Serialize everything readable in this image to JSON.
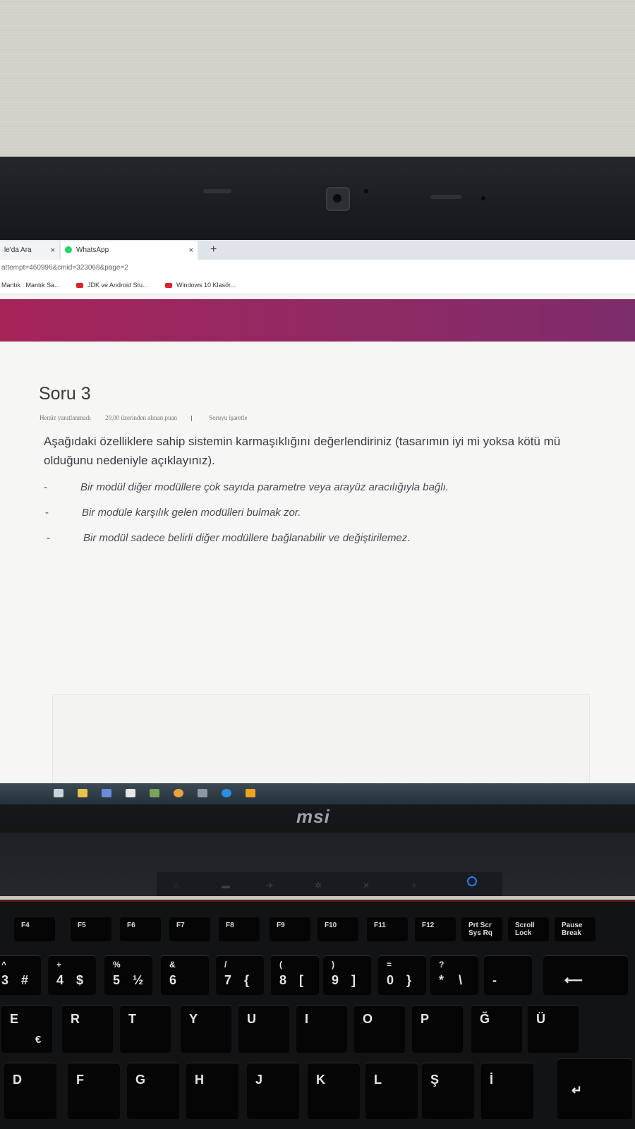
{
  "browser": {
    "tabs": [
      {
        "label": "le'da Ara"
      },
      {
        "label": "WhatsApp"
      }
    ],
    "url": "attempt=460996&cmid=323068&page=2",
    "bookmarks": [
      {
        "label": "Mantık : Mantık Sa..."
      },
      {
        "label": "JDK ve Android Stu..."
      },
      {
        "label": "Windows 10 Klasör..."
      }
    ],
    "accent_color": "#a52458"
  },
  "question": {
    "title": "Soru 3",
    "status": "Henüz yanıtlanmadı",
    "points": "20,00 üzerinden alınan puan",
    "flag_label": "Soruyu işaretle",
    "text": "Aşağıdaki özelliklere sahip sistemin karmaşıklığını değerlendiriniz (tasarımın iyi mi yoksa kötü mü olduğunu nedeniyle açıklayınız).",
    "bullets": [
      "Bir modül diğer modüllere çok sayıda parametre veya arayüz aracılığıyla bağlı.",
      "Bir modüle karşılık gelen modülleri bulmak zor.",
      "Bir modül sadece belirli diğer modüllere bağlanabilir ve değiştirilemez."
    ]
  },
  "laptop": {
    "brand": "msi"
  },
  "keyboard": {
    "fn_row": [
      "F4",
      "F5",
      "F6",
      "F7",
      "F8",
      "F9",
      "F10",
      "F11",
      "F12",
      "Prt Scr Sys Rq",
      "Scroll Lock",
      "Pause Break"
    ],
    "number_row": [
      {
        "main": "3",
        "sub": "^"
      },
      {
        "main": "#",
        "sub": ""
      },
      {
        "main": "4",
        "sub": "+"
      },
      {
        "main": "$",
        "sub": ""
      },
      {
        "main": "5",
        "sub": "%"
      },
      {
        "main": "½",
        "sub": ""
      },
      {
        "main": "6",
        "sub": "&"
      },
      {
        "main": "7",
        "sub": "/"
      },
      {
        "main": "{",
        "sub": ""
      },
      {
        "main": "8",
        "sub": "("
      },
      {
        "main": "[",
        "sub": ""
      },
      {
        "main": "9",
        "sub": ")"
      },
      {
        "main": "]",
        "sub": ""
      },
      {
        "main": "0",
        "sub": "="
      },
      {
        "main": "}",
        "sub": ""
      },
      {
        "main": "*",
        "sub": "?"
      },
      {
        "main": "\\",
        "sub": ""
      },
      {
        "main": "-",
        "sub": ""
      }
    ],
    "q_row": [
      "E",
      "R",
      "T",
      "Y",
      "U",
      "I",
      "O",
      "P",
      "Ğ",
      "Ü"
    ],
    "q_row_extra": [
      "€",
      "İ"
    ],
    "a_row": [
      "D",
      "F",
      "G",
      "H",
      "J",
      "K",
      "L",
      "Ş",
      "İ"
    ]
  }
}
